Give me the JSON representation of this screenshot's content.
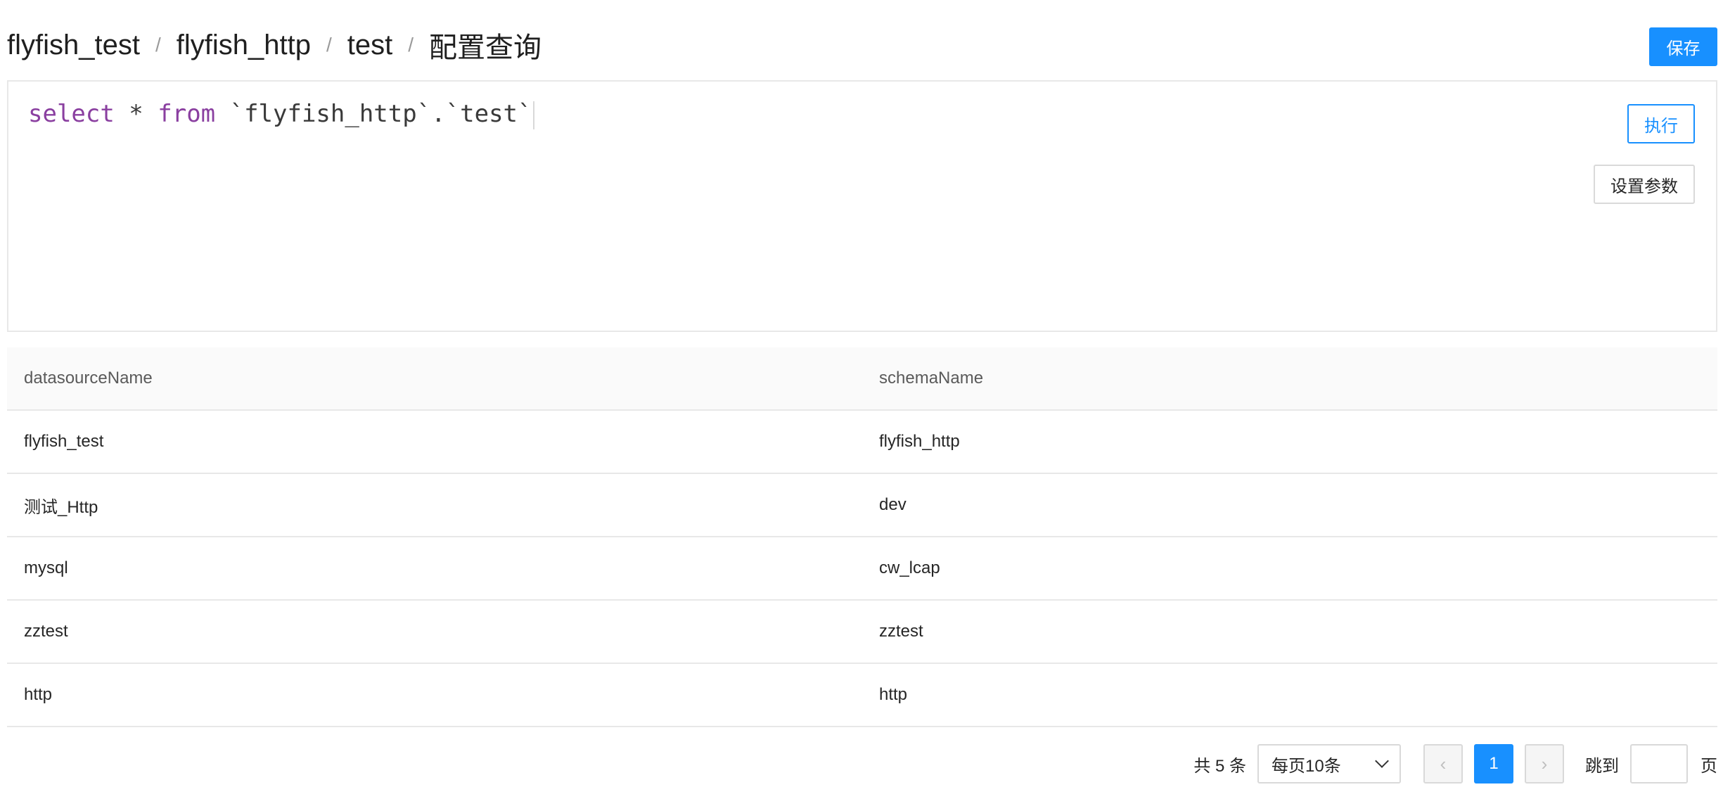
{
  "breadcrumb": {
    "items": [
      "flyfish_test",
      "flyfish_http",
      "test"
    ],
    "current": "配置查询",
    "separator": "/"
  },
  "toolbar": {
    "save_label": "保存"
  },
  "editor": {
    "kw_select": "select",
    "star": " * ",
    "kw_from": "from",
    "rest": " `flyfish_http`.`test`",
    "run_label": "执行",
    "params_label": "设置参数"
  },
  "table": {
    "columns": [
      "datasourceName",
      "schemaName"
    ],
    "rows": [
      [
        "flyfish_test",
        "flyfish_http"
      ],
      [
        "测试_Http",
        "dev"
      ],
      [
        "mysql",
        "cw_lcap"
      ],
      [
        "zztest",
        "zztest"
      ],
      [
        "http",
        "http"
      ]
    ]
  },
  "pagination": {
    "total_text": "共 5 条",
    "page_size": "每页10条",
    "prev_icon": "‹",
    "next_icon": "›",
    "current_page": "1",
    "jump_label": "跳到",
    "jump_suffix": "页"
  },
  "colors": {
    "primary": "#1890ff",
    "keyword": "#8a3fa0"
  }
}
